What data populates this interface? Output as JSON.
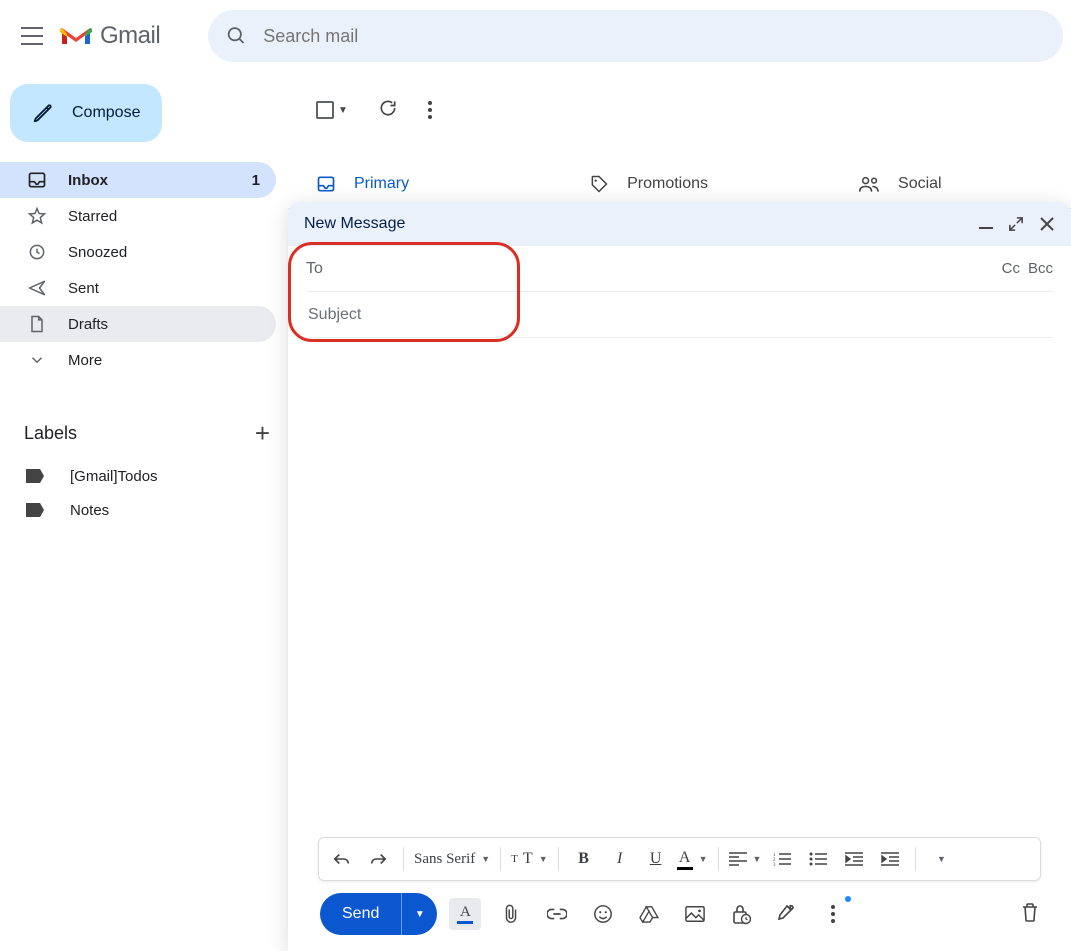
{
  "header": {
    "brand": "Gmail",
    "search_placeholder": "Search mail"
  },
  "compose_button": "Compose",
  "nav": {
    "inbox": {
      "label": "Inbox",
      "count": "1"
    },
    "starred": "Starred",
    "snoozed": "Snoozed",
    "sent": "Sent",
    "drafts": "Drafts",
    "more": "More"
  },
  "labels": {
    "header": "Labels",
    "items": [
      "[Gmail]Todos",
      "Notes"
    ]
  },
  "tabs": {
    "primary": "Primary",
    "promotions": "Promotions",
    "social": "Social"
  },
  "compose": {
    "title": "New Message",
    "to_label": "To",
    "cc": "Cc",
    "bcc": "Bcc",
    "subject_placeholder": "Subject",
    "font": "Sans Serif",
    "send": "Send"
  }
}
